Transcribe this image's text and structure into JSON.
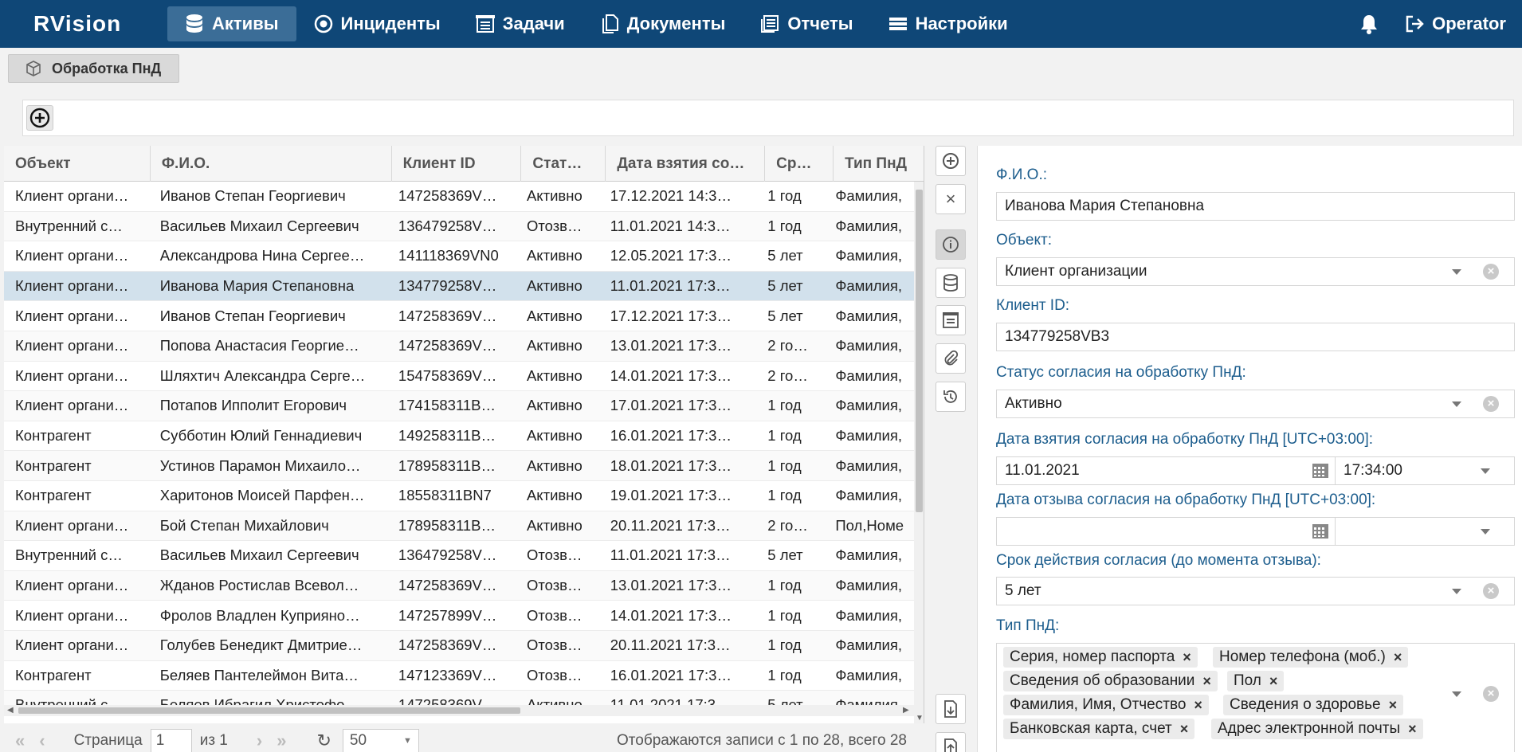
{
  "nav": {
    "logo": "RVision",
    "items": [
      {
        "label": "Активы",
        "icon": "database-icon",
        "active": true
      },
      {
        "label": "Инциденты",
        "icon": "target-icon",
        "active": false
      },
      {
        "label": "Задачи",
        "icon": "tasks-icon",
        "active": false
      },
      {
        "label": "Документы",
        "icon": "documents-icon",
        "active": false
      },
      {
        "label": "Отчеты",
        "icon": "reports-icon",
        "active": false
      },
      {
        "label": "Настройки",
        "icon": "settings-list-icon",
        "active": false
      }
    ],
    "user": "Operator"
  },
  "tab": {
    "label": "Обработка ПнД"
  },
  "grid": {
    "columns": [
      "Объект",
      "Ф.И.О.",
      "Клиент ID",
      "Стат…",
      "Дата взятия со…",
      "Ср…",
      "Тип ПнД"
    ],
    "rows": [
      [
        "Клиент органи…",
        "Иванов Степан Георгиевич",
        "147258369V…",
        "Активно",
        "17.12.2021 14:3…",
        "1 год",
        "Фамилия,"
      ],
      [
        "Внутренний с…",
        "Васильев Михаил Сергеевич",
        "136479258V…",
        "Отозв…",
        "11.01.2021 14:3…",
        "1 год",
        "Фамилия,"
      ],
      [
        "Клиент органи…",
        "Александрова Нина Сергее…",
        "141118369VN0",
        "Активно",
        "12.05.2021 17:3…",
        "5 лет",
        "Фамилия,"
      ],
      [
        "Клиент органи…",
        "Иванова Мария Степановна",
        "134779258V…",
        "Активно",
        "11.01.2021 17:3…",
        "5 лет",
        "Фамилия,"
      ],
      [
        "Клиент органи…",
        "Иванов Степан Георгиевич",
        "147258369V…",
        "Активно",
        "17.12.2021 17:3…",
        "5 лет",
        "Фамилия,"
      ],
      [
        "Клиент органи…",
        "Попова Анастасия Георгие…",
        "147258369V…",
        "Активно",
        "13.01.2021 17:3…",
        "2 го…",
        "Фамилия,"
      ],
      [
        "Клиент органи…",
        "Шляхтич Александра Серге…",
        "154758369V…",
        "Активно",
        "14.01.2021 17:3…",
        "2 го…",
        "Фамилия,"
      ],
      [
        "Клиент органи…",
        "Потапов Ипполит Егорович",
        "174158311B…",
        "Активно",
        "17.01.2021 17:3…",
        "1 год",
        "Фамилия,"
      ],
      [
        "Контрагент",
        "Субботин Юлий Геннадиевич",
        "149258311B…",
        "Активно",
        "16.01.2021 17:3…",
        "1 год",
        "Фамилия,"
      ],
      [
        "Контрагент",
        "Устинов Парамон Михаило…",
        "178958311B…",
        "Активно",
        "18.01.2021 17:3…",
        "1 год",
        "Фамилия,"
      ],
      [
        "Контрагент",
        "Харитонов Моисей Парфен…",
        "18558311BN7",
        "Активно",
        "19.01.2021 17:3…",
        "1 год",
        "Фамилия,"
      ],
      [
        "Клиент органи…",
        "Бой Степан Михайлович",
        "178958311B…",
        "Активно",
        "20.11.2021 17:3…",
        "2 го…",
        "Пол,Номе"
      ],
      [
        "Внутренний с…",
        "Васильев Михаил Сергеевич",
        "136479258V…",
        "Отозв…",
        "11.01.2021 17:3…",
        "5 лет",
        "Фамилия,"
      ],
      [
        "Клиент органи…",
        "Жданов Ростислав Всевол…",
        "147258369V…",
        "Отозв…",
        "13.01.2021 17:3…",
        "1 год",
        "Фамилия,"
      ],
      [
        "Клиент органи…",
        "Фролов Владлен Куприяно…",
        "147257899V…",
        "Отозв…",
        "14.01.2021 17:3…",
        "1 год",
        "Фамилия,"
      ],
      [
        "Клиент органи…",
        "Голубев Бенедикт Дмитрие…",
        "147258369V…",
        "Отозв…",
        "20.11.2021 17:3…",
        "1 год",
        "Фамилия,"
      ],
      [
        "Контрагент",
        "Беляев Пантелеймон Вита…",
        "147123369V…",
        "Отозв…",
        "16.01.2021 17:3…",
        "1 год",
        "Фамилия,"
      ],
      [
        "Внутренний с…",
        "Беляев Ибрагил Христофо…",
        "147258369V…",
        "Активно",
        "11.01.2021 17:3…",
        "5 лет",
        "Фамилия,"
      ]
    ],
    "selected_row": 3
  },
  "pager": {
    "page_label": "Страница",
    "page": "1",
    "of_label": "из 1",
    "page_size": "50",
    "summary": "Отображаются записи с 1 по 28, всего 28"
  },
  "detail": {
    "fio_label": "Ф.И.О.:",
    "fio_value": "Иванова Мария Степановна",
    "object_label": "Объект:",
    "object_value": "Клиент организации",
    "client_id_label": "Клиент ID:",
    "client_id_value": "134779258VB3",
    "status_label": "Статус согласия на обработку ПнД:",
    "status_value": "Активно",
    "date_taken_label": "Дата взятия согласия на обработку ПнД [UTC+03:00]:",
    "date_taken_value": "11.01.2021",
    "time_taken_value": "17:34:00",
    "date_revoked_label": "Дата отзыва согласия на обработку ПнД [UTC+03:00]:",
    "date_revoked_value": "",
    "time_revoked_value": "",
    "term_label": "Срок действия согласия (до момента отзыва):",
    "term_value": "5 лет",
    "type_label": "Тип ПнД:",
    "tags": [
      "Серия, номер паспорта",
      "Номер телефона (моб.)",
      "Сведения об образовании",
      "Пол",
      "Фамилия, Имя, Отчество",
      "Сведения о здоровье",
      "Банковская карта, счет",
      "Адрес электронной почты"
    ]
  }
}
